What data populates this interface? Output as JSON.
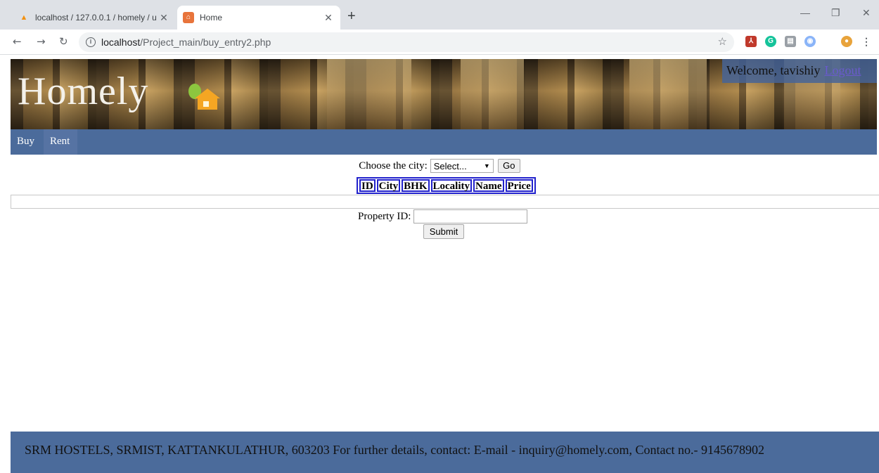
{
  "browser": {
    "tabs": [
      {
        "title": "localhost / 127.0.0.1 / homely / u",
        "icon": "phpmyadmin-icon"
      },
      {
        "title": "Home",
        "icon": "home-favicon"
      }
    ],
    "url_host": "localhost",
    "url_path": "/Project_main/buy_entry2.php"
  },
  "header": {
    "logo": "Homely",
    "welcome": "Welcome, tavishiy",
    "logout": "Logout"
  },
  "nav": {
    "buy": "Buy",
    "rent": "Rent"
  },
  "city": {
    "label": "Choose the city:",
    "selected": "Select...",
    "go": "Go"
  },
  "table": {
    "headers": [
      "ID",
      "City",
      "BHK",
      "Locality",
      "Name",
      "Price"
    ]
  },
  "property": {
    "label": "Property ID:",
    "value": "",
    "submit": "Submit"
  },
  "footer": {
    "text": "SRM HOSTELS, SRMIST, KATTANKULATHUR, 603203  For further details, contact: E-mail - inquiry@homely.com, Contact no.- 9145678902"
  },
  "colors": {
    "nav_bg": "#4b6b9b",
    "table_border": "#2222cc",
    "logout_link": "#6a5acd"
  }
}
